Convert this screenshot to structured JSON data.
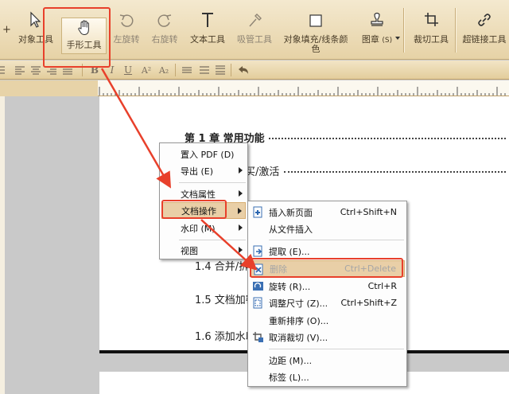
{
  "toolbar": {
    "left_partial": "+",
    "tools": [
      {
        "id": "object-tool",
        "label": "对象工具"
      },
      {
        "id": "hand-tool",
        "label": "手形工具"
      },
      {
        "id": "rotate-left",
        "label": "左旋转"
      },
      {
        "id": "rotate-right",
        "label": "右旋转"
      },
      {
        "id": "text-tool",
        "label": "文本工具"
      },
      {
        "id": "eyedropper-tool",
        "label": "吸管工具"
      },
      {
        "id": "object-fill",
        "label": "对象填充/线条颜色"
      },
      {
        "id": "stamp",
        "label": "图章",
        "shortcut": "(S)"
      },
      {
        "id": "crop-tool",
        "label": "裁切工具"
      },
      {
        "id": "hyperlink-tool",
        "label": "超链接工具"
      }
    ]
  },
  "formatbar": {
    "bold": "B",
    "italic": "I",
    "underline": "U",
    "superscript": "A²",
    "subscript": "A₂"
  },
  "document": {
    "chapter": "第 1 章  常用功能",
    "line2_partial": "买/激活",
    "line3_partial": "1.4 合并/拆",
    "line4_partial": "1.5 文档加密",
    "line5_partial": "1.6 添加水印"
  },
  "context_menu": {
    "items": [
      {
        "label": "置入 PDF (D)",
        "submenu": false
      },
      {
        "label": "导出 (E)",
        "submenu": true
      },
      {
        "label": "文档属性",
        "submenu": true
      },
      {
        "label": "文档操作",
        "submenu": true
      },
      {
        "label": "水印 (M)",
        "submenu": true
      },
      {
        "label": "视图",
        "submenu": true
      }
    ]
  },
  "submenu": {
    "items": [
      {
        "label": "插入新页面",
        "shortcut": "Ctrl+Shift+N",
        "icon": "insert-page-icon"
      },
      {
        "label": "从文件插入",
        "shortcut": "",
        "icon": ""
      },
      {
        "label": "提取 (E)...",
        "shortcut": "",
        "icon": "extract-page-icon"
      },
      {
        "label": "删除",
        "shortcut": "Ctrl+Delete",
        "icon": "delete-page-icon"
      },
      {
        "label": "旋转 (R)...",
        "shortcut": "Ctrl+R",
        "icon": "rotate-page-icon"
      },
      {
        "label": "调整尺寸 (Z)...",
        "shortcut": "Ctrl+Shift+Z",
        "icon": "resize-page-icon"
      },
      {
        "label": "重新排序 (O)...",
        "shortcut": "",
        "icon": ""
      },
      {
        "label": "取消裁切 (V)...",
        "shortcut": "",
        "icon": "uncrop-icon"
      },
      {
        "label": "边距 (M)...",
        "shortcut": "",
        "icon": ""
      },
      {
        "label": "标签 (L)...",
        "shortcut": "",
        "icon": ""
      }
    ]
  },
  "colors": {
    "annotation_red": "#e8402b",
    "menu_highlight": "#e9cfa7",
    "ribbon": "#ecdcb8"
  }
}
